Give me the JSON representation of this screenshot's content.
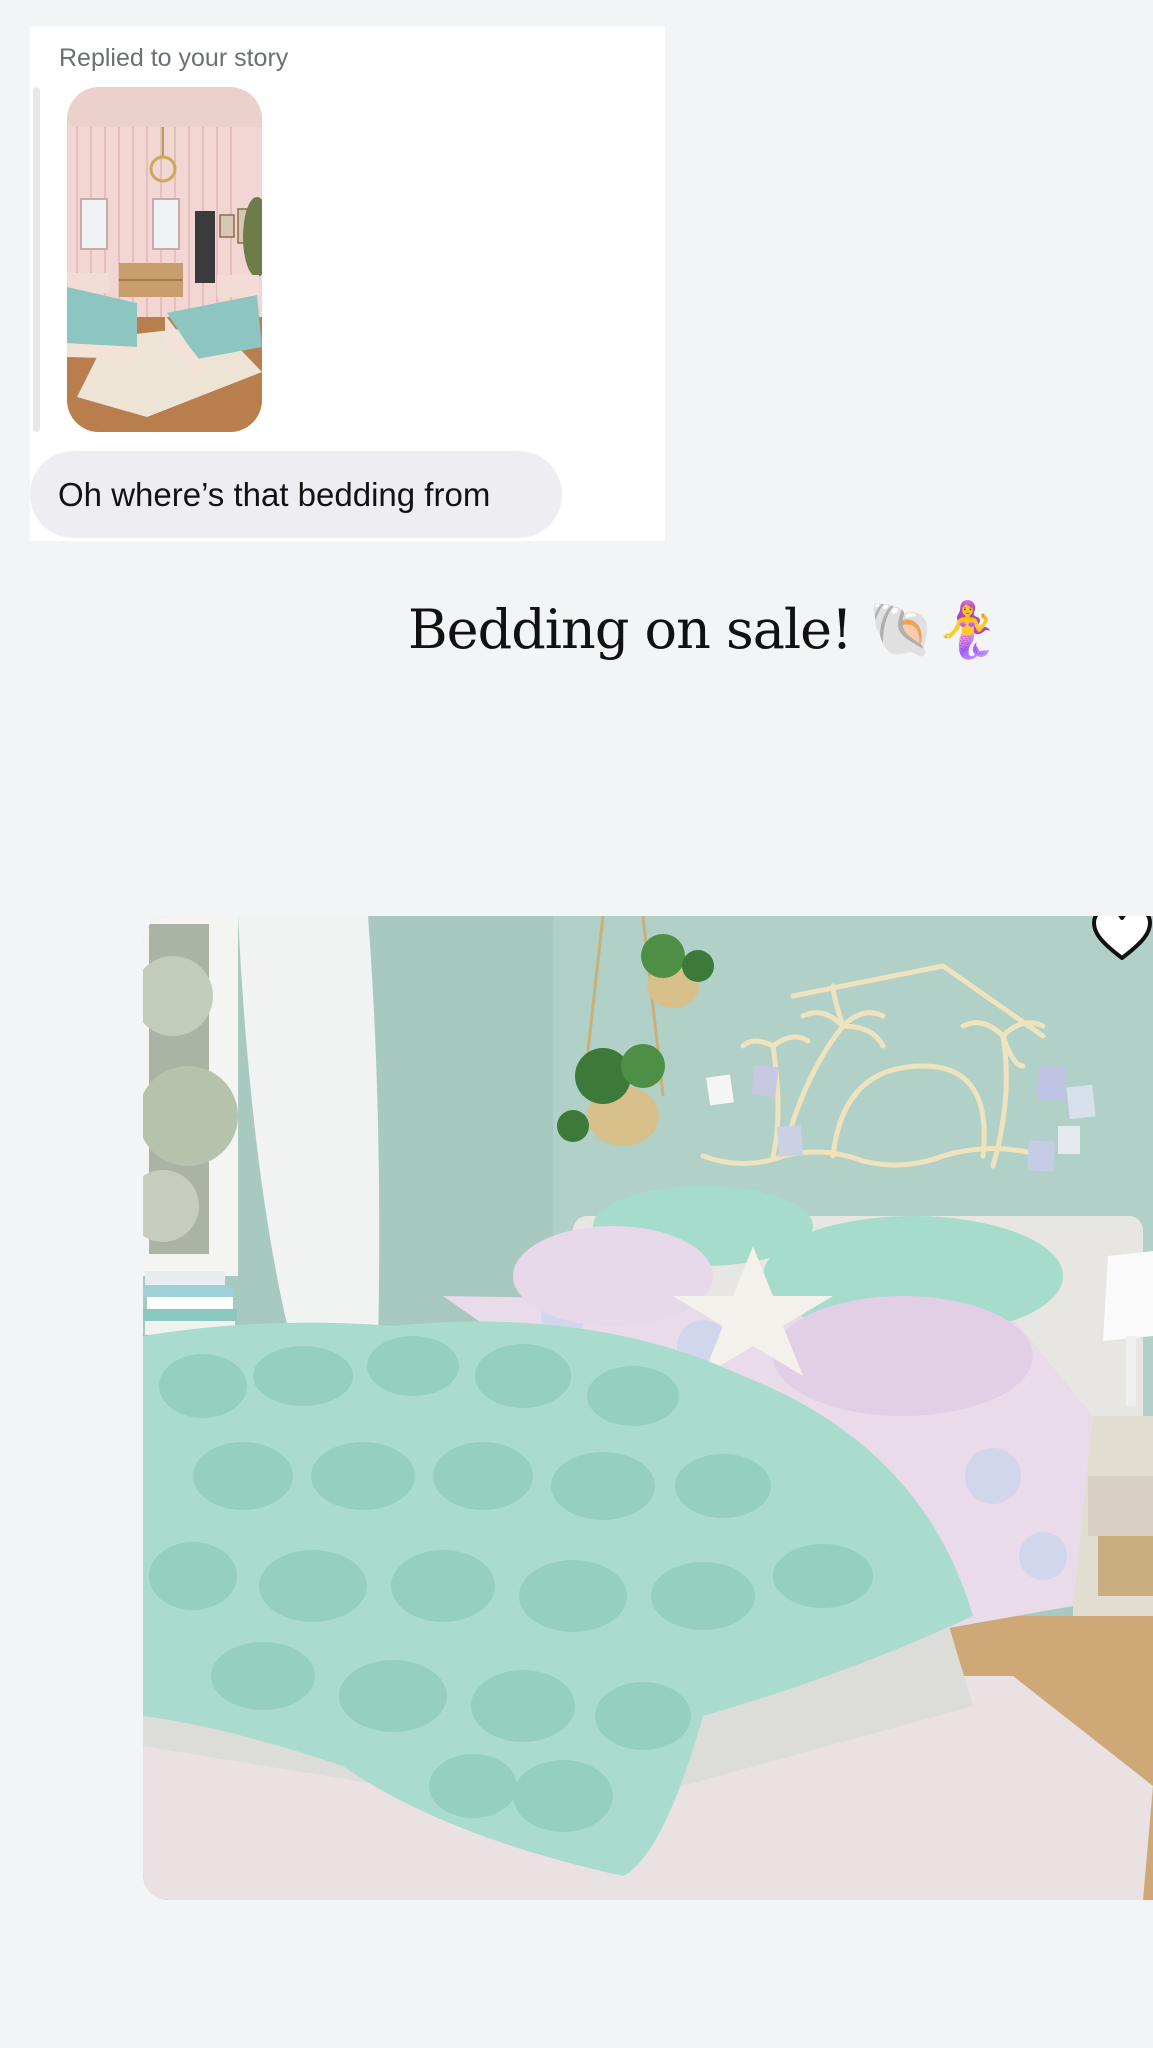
{
  "reply": {
    "label": "Replied to your story",
    "message": "Oh where’s that bedding from"
  },
  "story": {
    "caption": "Bedding on sale!",
    "emoji": "🐚🧜‍♀️"
  },
  "icons": {
    "like": "heart-icon"
  },
  "colors": {
    "background": "#f3f4f6",
    "bubble": "#eeeef2",
    "comforter": "#a9dccf",
    "wall": "#a8c9bf"
  }
}
